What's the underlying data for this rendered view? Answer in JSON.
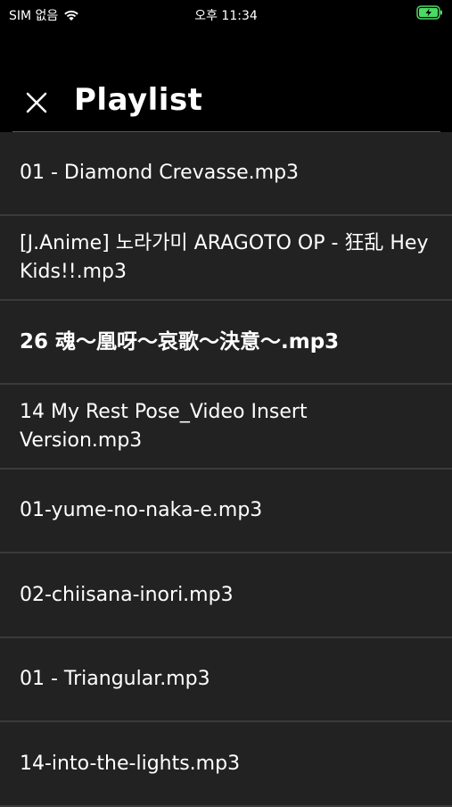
{
  "status_bar": {
    "carrier": "SIM 없음",
    "time": "오후 11:34"
  },
  "header": {
    "title": "Playlist"
  },
  "playlist": [
    {
      "label": "01 - Diamond Crevasse.mp3"
    },
    {
      "label": "[J.Anime] 노라가미 ARAGOTO OP - 狂乱 Hey Kids!!.mp3"
    },
    {
      "label": "26 魂～凰呀～哀歌～決意～.mp3",
      "current": true
    },
    {
      "label": "14 My Rest Pose_Video Insert Version.mp3"
    },
    {
      "label": "01-yume-no-naka-e.mp3"
    },
    {
      "label": "02-chiisana-inori.mp3"
    },
    {
      "label": "01 - Triangular.mp3"
    },
    {
      "label": "14-into-the-lights.mp3"
    }
  ],
  "colors": {
    "background": "#222222",
    "header_background": "#000000",
    "battery_charging": "#4cd964"
  }
}
